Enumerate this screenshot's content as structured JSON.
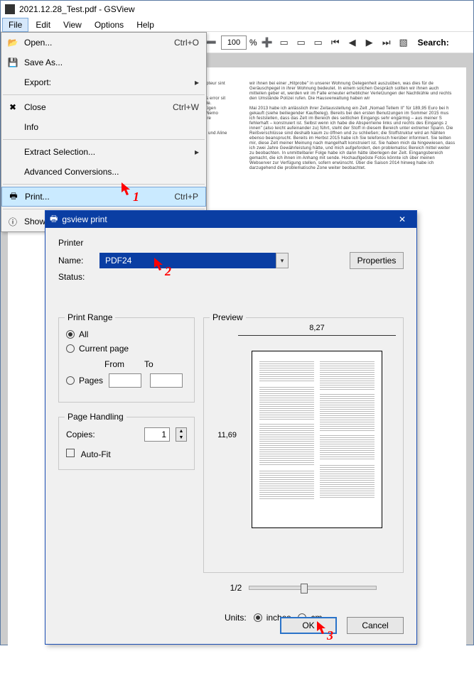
{
  "window": {
    "title": "2021.12.28_Test.pdf - GSView"
  },
  "menubar": {
    "file": "File",
    "edit": "Edit",
    "view": "View",
    "options": "Options",
    "help": "Help"
  },
  "toolbar": {
    "zoom": "100",
    "pct": "%",
    "search": "Search:"
  },
  "file_menu": {
    "open": "Open...",
    "open_accel": "Ctrl+O",
    "saveas": "Save As...",
    "export": "Export:",
    "close": "Close",
    "close_accel": "Ctrl+W",
    "info": "Info",
    "extract": "Extract Selection...",
    "advanced": "Advanced Conversions...",
    "print": "Print...",
    "print_accel": "Ctrl+P",
    "show_msg": "Show Messages"
  },
  "dialog": {
    "title": "gsview print",
    "printer_label": "Printer",
    "name_label": "Name:",
    "printer_name": "PDF24",
    "properties": "Properties",
    "status_label": "Status:",
    "range": {
      "legend": "Print Range",
      "all": "All",
      "current": "Current page",
      "pages": "Pages",
      "from": "From",
      "to": "To"
    },
    "handling": {
      "legend": "Page Handling",
      "copies_label": "Copies:",
      "copies": "1",
      "autofit": "Auto-Fit"
    },
    "preview": {
      "legend": "Preview",
      "width": "8,27",
      "height": "11,69",
      "ratio": "1/2"
    },
    "units": {
      "label": "Units:",
      "inches": "inches",
      "cm": "cm"
    },
    "ok": "OK",
    "cancel": "Cancel"
  },
  "annot": {
    "n1": "1",
    "n2": "2",
    "n3": "3"
  }
}
